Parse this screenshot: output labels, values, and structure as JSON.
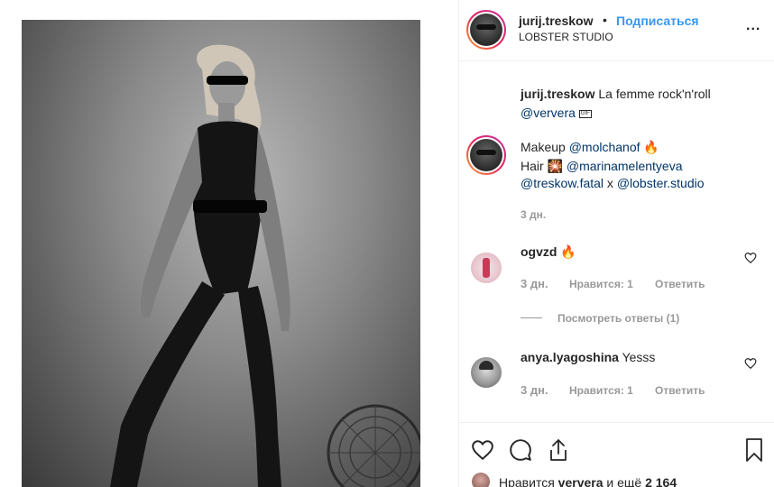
{
  "post": {
    "username": "jurij.treskow",
    "separator": "•",
    "follow_label": "Подписаться",
    "location": "LOBSTER STUDIO",
    "more_label": "..."
  },
  "caption": {
    "username": "jurij.treskow",
    "text": "La femme rock'n'roll",
    "mention": "@ververa",
    "gif_badge": "GIF"
  },
  "reply": {
    "line1_prefix": "Makeup",
    "line1_mention": "@molchanof",
    "line1_emoji": "🔥",
    "line2_prefix": "Hair",
    "line2_emoji": "🎇",
    "line2_mention": "@marinamelentyeva",
    "line3_mention1": "@treskow.fatal",
    "line3_x": "x",
    "line3_mention2": "@lobster.studio",
    "time": "3 дн."
  },
  "comments": [
    {
      "username": "ogvzd",
      "text": "🔥",
      "time": "3 дн.",
      "likes": "Нравится: 1",
      "reply_label": "Ответить",
      "view_replies": "Посмотреть ответы (1)"
    },
    {
      "username": "anya.lyagoshina",
      "text": "Yesss",
      "time": "3 дн.",
      "likes": "Нравится: 1",
      "reply_label": "Ответить"
    }
  ],
  "likes_bar": {
    "prefix": "Нравится",
    "user": "ververa",
    "middle": "и ещё",
    "count": "2 164"
  },
  "icons": {
    "like": "heart-icon",
    "comment": "comment-icon",
    "share": "share-icon",
    "save": "bookmark-icon",
    "more": "more-icon"
  },
  "colors": {
    "follow_blue": "#3897f0",
    "link_dark_blue": "#003569",
    "meta_gray": "#999999",
    "text": "#262626"
  }
}
